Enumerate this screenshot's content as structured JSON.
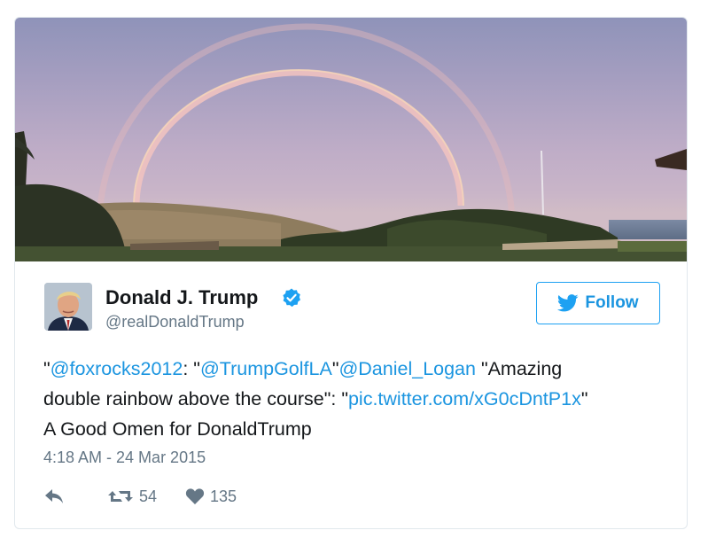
{
  "user": {
    "name": "Donald J. Trump",
    "handle": "@realDonaldTrump",
    "verified": true,
    "avatar_icon": "profile-photo"
  },
  "follow_button": {
    "label": "Follow",
    "icon": "twitter-bird-icon",
    "color": "#1da1f2"
  },
  "tweet": {
    "line1": [
      {
        "text": "\"",
        "link": false
      },
      {
        "text": "@foxrocks2012",
        "link": true
      },
      {
        "text": ": \"",
        "link": false
      },
      {
        "text": "@TrumpGolfLA",
        "link": true
      },
      {
        "text": "\"",
        "link": false
      },
      {
        "text": "@Daniel_Logan",
        "link": true
      },
      {
        "text": " \"Amazing",
        "link": false
      }
    ],
    "line2": [
      {
        "text": "double rainbow above the course\": \"",
        "link": false
      },
      {
        "text": "pic.twitter.com/xG0cDntP1x",
        "link": true
      },
      {
        "text": "\"",
        "link": false
      }
    ],
    "line3": [
      {
        "text": "A Good Omen for DonaldTrump",
        "link": false
      }
    ]
  },
  "timestamp": "4:18 AM - 24 Mar 2015",
  "actions": {
    "reply_icon": "reply-icon",
    "retweet_icon": "retweet-icon",
    "retweet_count": "54",
    "like_icon": "heart-icon",
    "like_count": "135"
  },
  "colors": {
    "link": "#1b95e0",
    "text": "#14171a",
    "muted": "#657786",
    "border": "#e1e8ed"
  }
}
